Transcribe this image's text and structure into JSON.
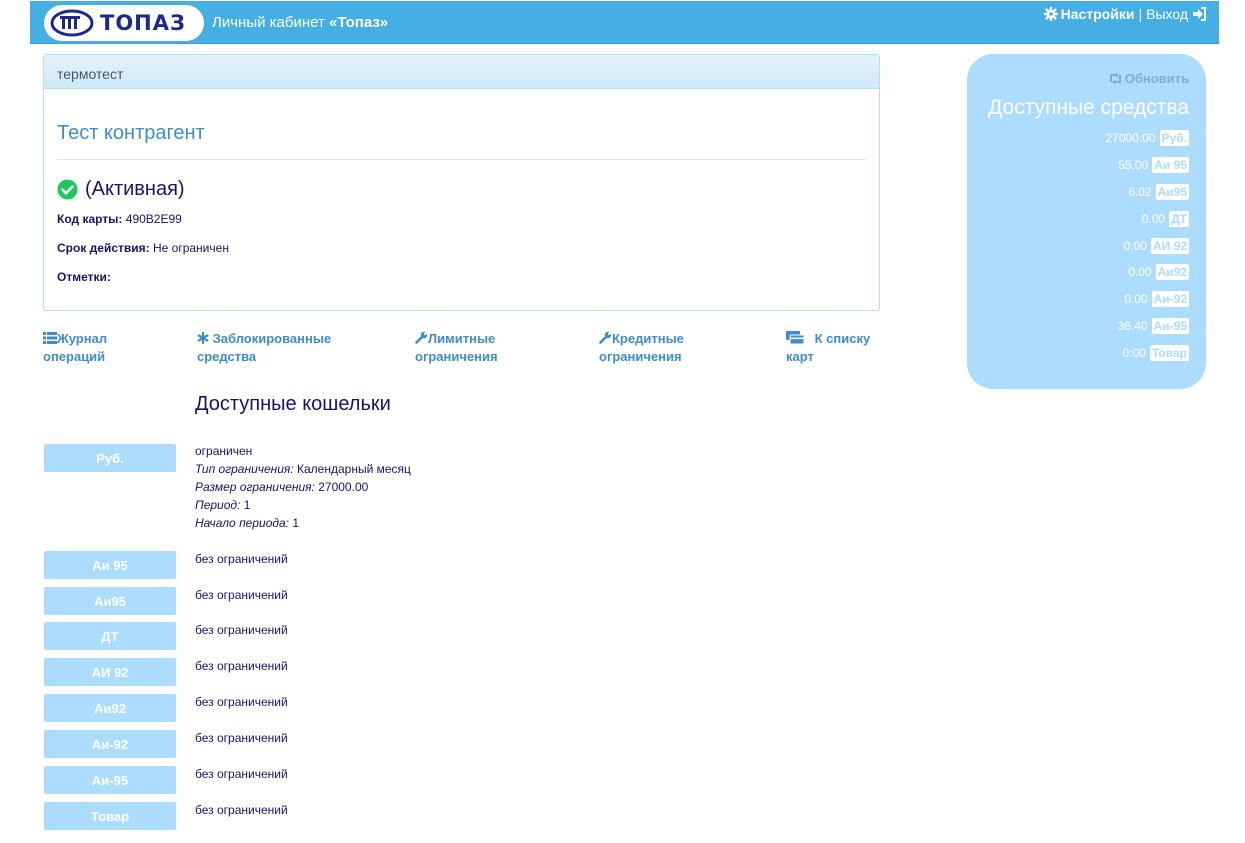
{
  "header": {
    "logo_text": "ТОПАЗ",
    "title_prefix": "Личный кабинет ",
    "title_strong": "«Топаз»",
    "settings_label": "Настройки",
    "separator": "|",
    "logout_label": "Выход",
    "bg_color": "#45aee3"
  },
  "card": {
    "panel_title": "термотест",
    "contractor": "Тест контрагент",
    "status": "(Активная)",
    "code_label": "Код карты:",
    "code_value": "490B2E99",
    "validity_label": "Срок действия:",
    "validity_value": "Не ограничен",
    "notes_label": "Отметки:"
  },
  "nav": {
    "journal_line1": "Журнал",
    "journal_line2": "операций",
    "blocked_line1": "Заблокированные",
    "blocked_line2": "средства",
    "limits_line1": "Лимитные",
    "limits_line2": "ограничения",
    "credit_line1": "Кредитные",
    "credit_line2": "ограничения",
    "cards_line1": "К списку",
    "cards_line2": "карт"
  },
  "wallets": {
    "title": "Доступные кошельки",
    "rub": {
      "label": "Руб.",
      "status": "ограничен",
      "type_label": "Тип ограничения:",
      "type_value": "Календарный месяц",
      "size_label": "Размер ограничения:",
      "size_value": "27000.00",
      "period_label": "Период:",
      "period_value": "1",
      "start_label": "Начало периода:",
      "start_value": "1"
    },
    "items": [
      {
        "label": "Аи 95",
        "desc": "без ограничений"
      },
      {
        "label": "Аи95",
        "desc": "без ограничений"
      },
      {
        "label": "ДТ",
        "desc": "без ограничений"
      },
      {
        "label": "АИ 92",
        "desc": "без ограничений"
      },
      {
        "label": "Аи92",
        "desc": "без ограничений"
      },
      {
        "label": "Аи-92",
        "desc": "без ограничений"
      },
      {
        "label": "Аи-95",
        "desc": "без ограничений"
      },
      {
        "label": "Товар",
        "desc": "без ограничений"
      }
    ]
  },
  "balance": {
    "refresh_label": "Обновить",
    "title": "Доступные средства",
    "rows": [
      {
        "amount": "27000.00",
        "unit": "Руб."
      },
      {
        "amount": "55.00",
        "unit": "Аи 95"
      },
      {
        "amount": "6.02",
        "unit": "Аи95"
      },
      {
        "amount": "0.00",
        "unit": "ДТ"
      },
      {
        "amount": "0.00",
        "unit": "АИ 92"
      },
      {
        "amount": "0.00",
        "unit": "Аи92"
      },
      {
        "amount": "0.00",
        "unit": "Аи-92"
      },
      {
        "amount": "36.40",
        "unit": "Аи-95"
      },
      {
        "amount": "0:00",
        "unit": "Товар"
      }
    ]
  }
}
